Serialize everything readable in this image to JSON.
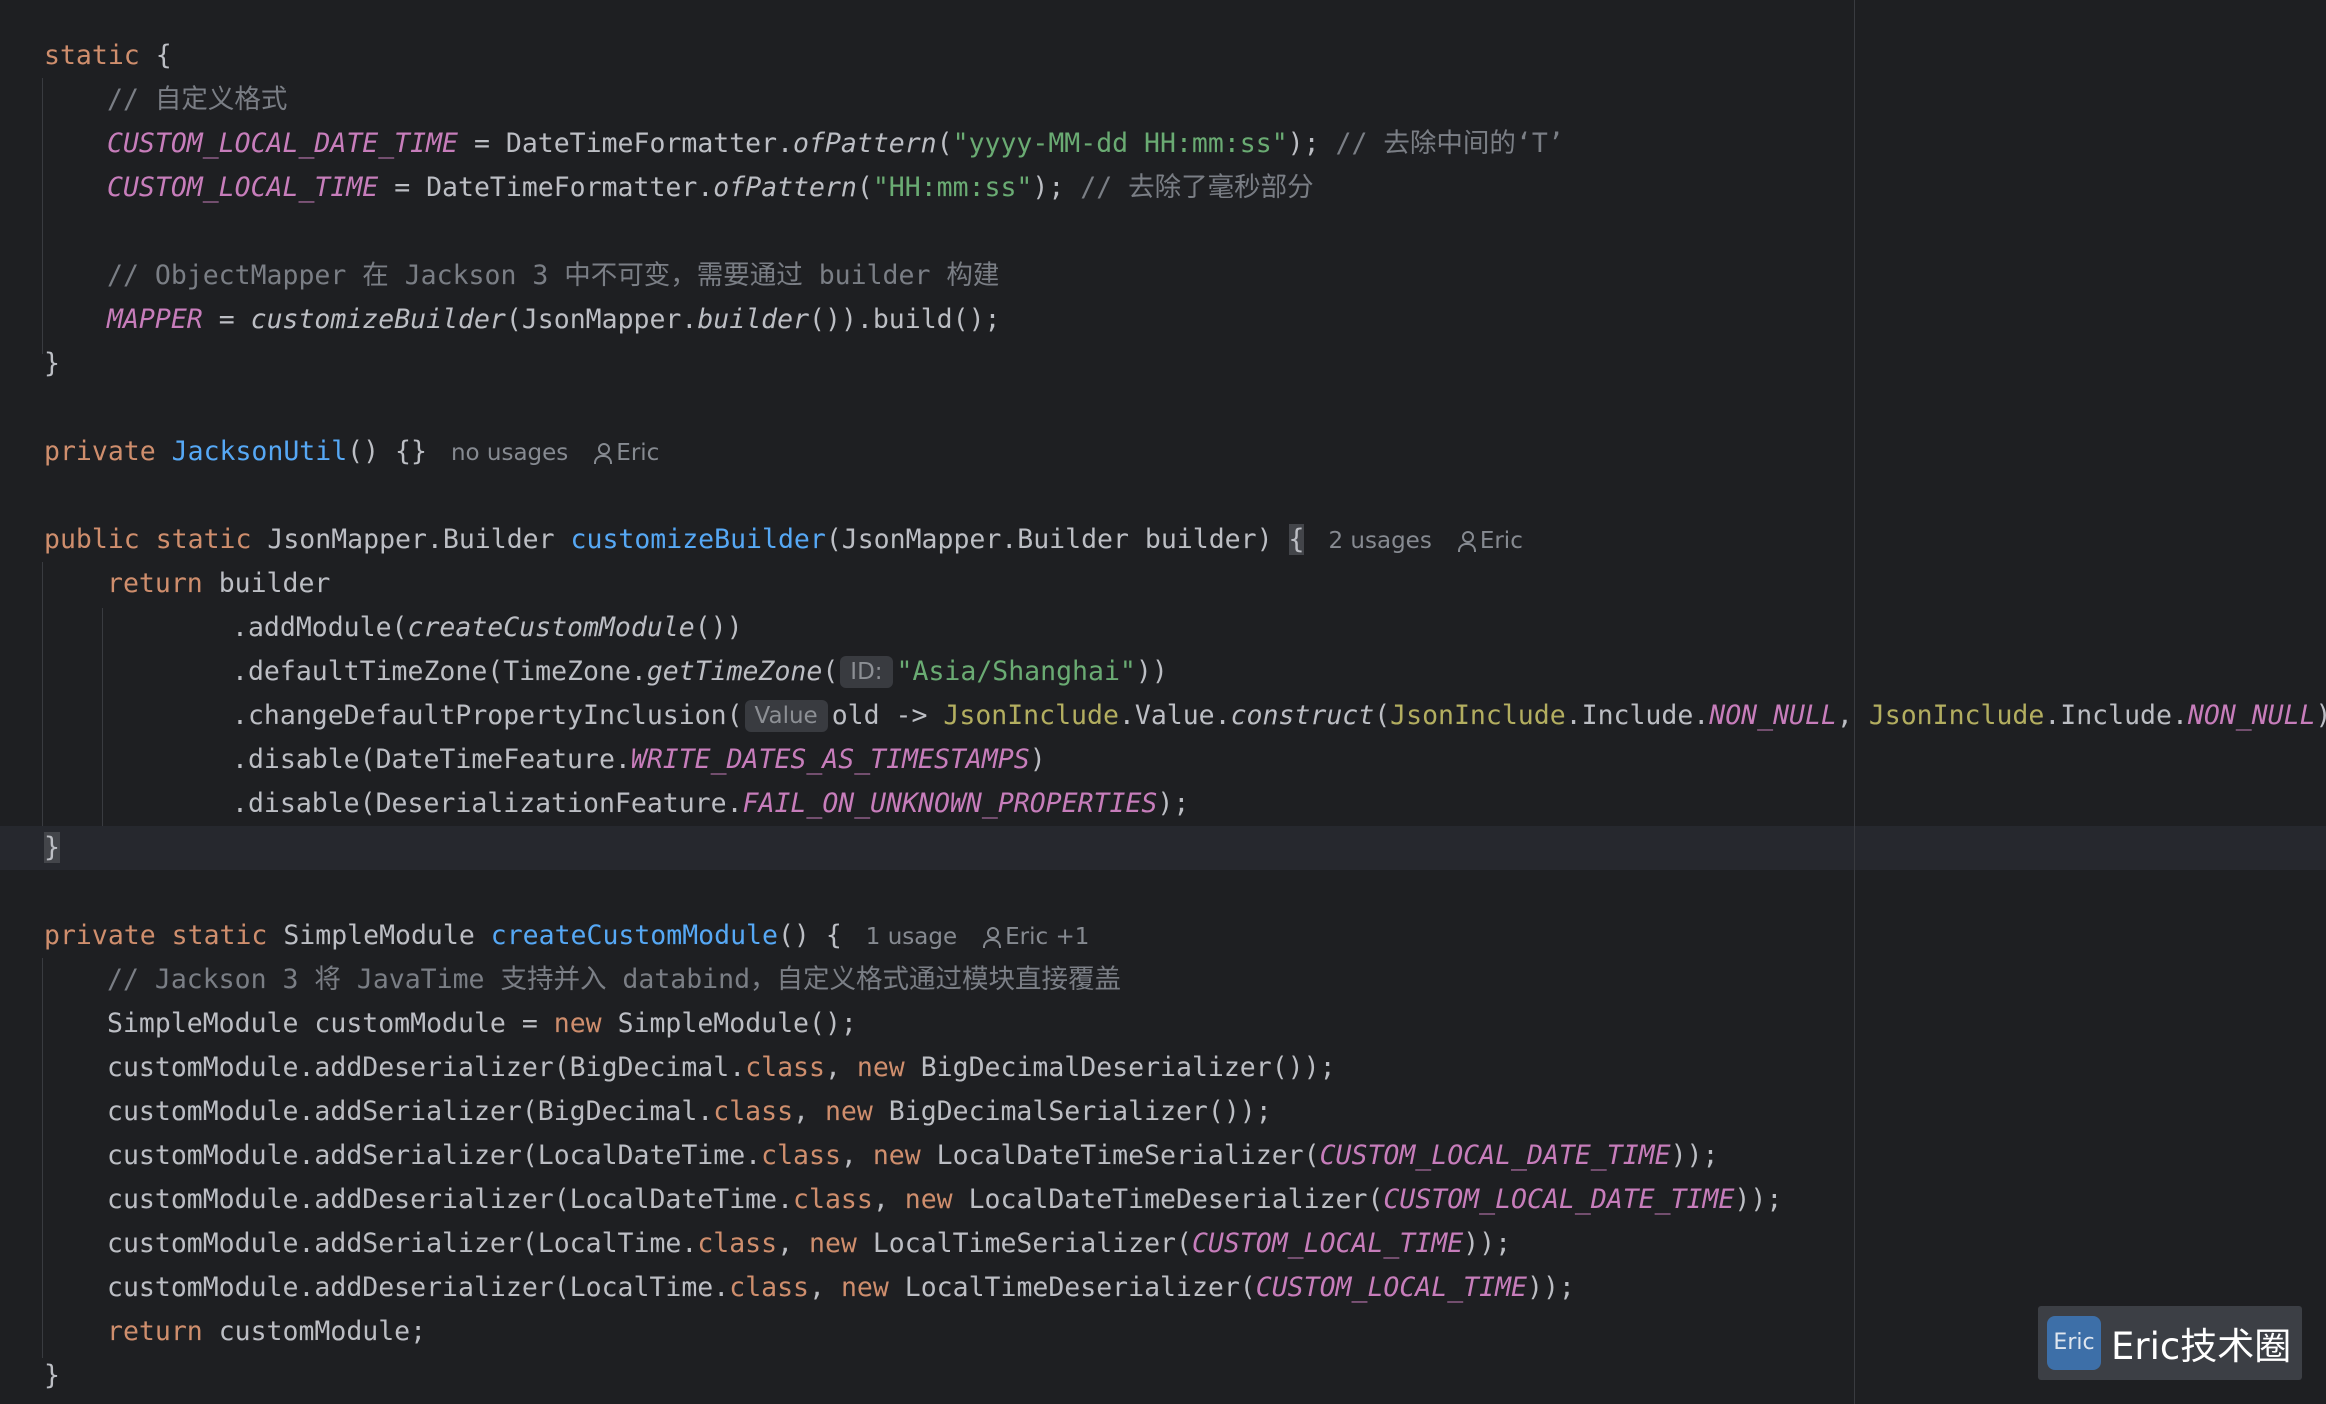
{
  "code": {
    "l1": {
      "kw": "static",
      "rest": " {"
    },
    "l2": {
      "comment": "// 自定义格式"
    },
    "l3": {
      "c1": "CUSTOM_LOCAL_DATE_TIME",
      "t1": " = DateTimeFormatter.",
      "m": "ofPattern",
      "t2": "(",
      "s": "\"yyyy-MM-dd HH:mm:ss\"",
      "t3": "); ",
      "comment": "// 去除中间的‘T’"
    },
    "l4": {
      "c1": "CUSTOM_LOCAL_TIME",
      "t1": " = DateTimeFormatter.",
      "m": "ofPattern",
      "t2": "(",
      "s": "\"HH:mm:ss\"",
      "t3": "); ",
      "comment": "// 去除了毫秒部分"
    },
    "l6": {
      "comment": "// ObjectMapper 在 Jackson 3 中不可变，需要通过 builder 构建"
    },
    "l7": {
      "c1": "MAPPER",
      "t1": " = ",
      "m1": "customizeBuilder",
      "t2": "(JsonMapper.",
      "m2": "builder",
      "t3": "()).build();"
    },
    "l8": {
      "text": "}"
    },
    "l10": {
      "kw": "private",
      "sp": " ",
      "name": "JacksonUtil",
      "rest": "() {}",
      "usages": "no usages",
      "author": "Eric"
    },
    "l12": {
      "kw1": "public",
      "sp1": " ",
      "kw2": "static",
      "t1": " JsonMapper.Builder ",
      "name": "customizeBuilder",
      "t2": "(JsonMapper.Builder builder) ",
      "brace": "{",
      "usages": "2 usages",
      "author": "Eric"
    },
    "l13": {
      "kw": "return",
      "rest": " builder"
    },
    "l14": {
      "t1": ".addModule(",
      "m": "createCustomModule",
      "t2": "())"
    },
    "l15": {
      "t1": ".defaultTimeZone(TimeZone.",
      "m": "getTimeZone",
      "t2": "(",
      "hint": "ID:",
      "s": "\"Asia/Shanghai\"",
      "t3": "))"
    },
    "l16": {
      "t1": ".changeDefaultPropertyInclusion(",
      "hint": "Value",
      "t2": "old -> ",
      "a1": "JsonInclude",
      "t3": ".Value.",
      "m": "construct",
      "t4": "(",
      "a2": "JsonInclude",
      "t5": ".Include.",
      "c1": "NON_NULL",
      "t6": ", ",
      "a3": "JsonInclude",
      "t7": ".Include.",
      "c2": "NON_NULL",
      "t8": "))"
    },
    "l17": {
      "t1": ".disable(DateTimeFeature.",
      "c": "WRITE_DATES_AS_TIMESTAMPS",
      "t2": ")"
    },
    "l18": {
      "t1": ".disable(DeserializationFeature.",
      "c": "FAIL_ON_UNKNOWN_PROPERTIES",
      "t2": ");"
    },
    "l19": {
      "text": "}"
    },
    "l21": {
      "kw1": "private",
      "sp1": " ",
      "kw2": "static",
      "t1": " SimpleModule ",
      "name": "createCustomModule",
      "rest": "() {",
      "usages": "1 usage",
      "author": "Eric +1"
    },
    "l22": {
      "comment": "// Jackson 3 将 JavaTime 支持并入 databind，自定义格式通过模块直接覆盖"
    },
    "l23": {
      "t1": "SimpleModule customModule = ",
      "kw": "new",
      "t2": " SimpleModule();"
    },
    "l24": {
      "t1": "customModule.addDeserializer(BigDecimal.",
      "kw1": "class",
      "t2": ", ",
      "kw2": "new",
      "t3": " BigDecimalDeserializer());"
    },
    "l25": {
      "t1": "customModule.addSerializer(BigDecimal.",
      "kw1": "class",
      "t2": ", ",
      "kw2": "new",
      "t3": " BigDecimalSerializer());"
    },
    "l26": {
      "t1": "customModule.addSerializer(LocalDateTime.",
      "kw1": "class",
      "t2": ", ",
      "kw2": "new",
      "t3": " LocalDateTimeSerializer(",
      "c": "CUSTOM_LOCAL_DATE_TIME",
      "t4": "));"
    },
    "l27": {
      "t1": "customModule.addDeserializer(LocalDateTime.",
      "kw1": "class",
      "t2": ", ",
      "kw2": "new",
      "t3": " LocalDateTimeDeserializer(",
      "c": "CUSTOM_LOCAL_DATE_TIME",
      "t4": "));"
    },
    "l28": {
      "t1": "customModule.addSerializer(LocalTime.",
      "kw1": "class",
      "t2": ", ",
      "kw2": "new",
      "t3": " LocalTimeSerializer(",
      "c": "CUSTOM_LOCAL_TIME",
      "t4": "));"
    },
    "l29": {
      "t1": "customModule.addDeserializer(LocalTime.",
      "kw1": "class",
      "t2": ", ",
      "kw2": "new",
      "t3": " LocalTimeDeserializer(",
      "c": "CUSTOM_LOCAL_TIME",
      "t4": "));"
    },
    "l30": {
      "kw": "return",
      "rest": " customModule;"
    },
    "l31": {
      "text": "}"
    }
  },
  "watermark": {
    "logo": "Eric",
    "text": "Eric技术圈"
  },
  "icons": {
    "author": "user-icon",
    "logo": "eric-logo-icon"
  },
  "colors": {
    "background": "#1e1f22",
    "keyword": "#cf8e6d",
    "comment": "#7a7e85",
    "string": "#6aab73",
    "constant": "#c77dbb",
    "method_decl": "#56a8f5",
    "annotation_type": "#b3ae60"
  }
}
